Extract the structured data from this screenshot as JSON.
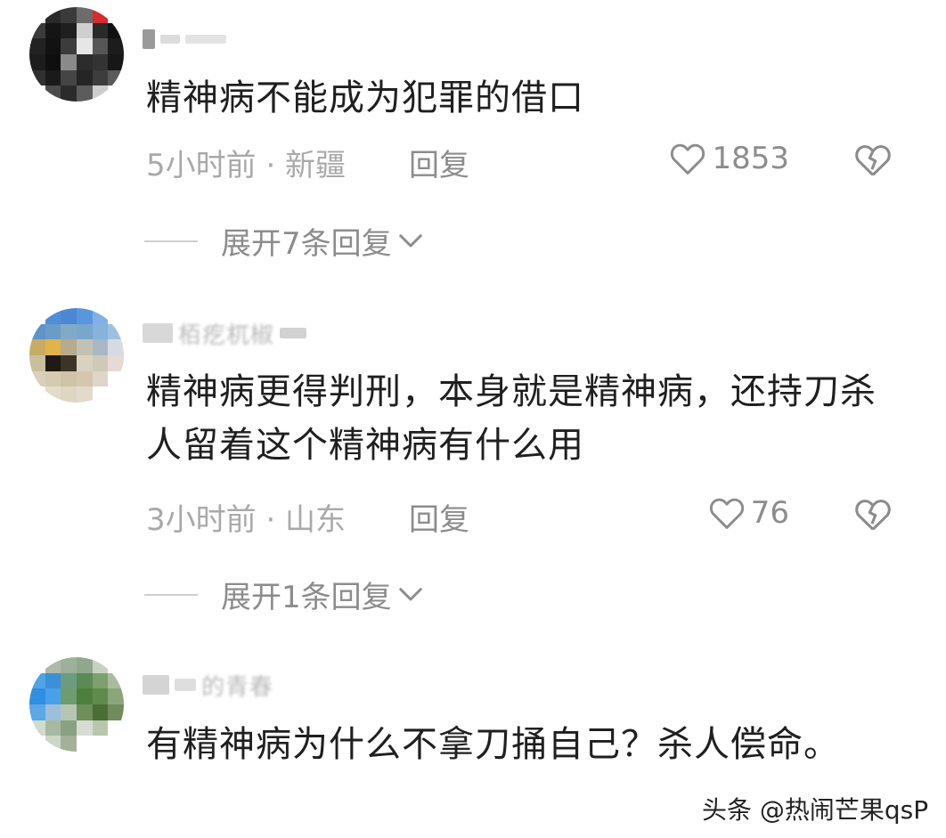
{
  "comments": [
    {
      "text": "精神病不能成为犯罪的借口",
      "time_location": "5小时前 · 新疆",
      "reply_label": "回复",
      "likes": "1853",
      "expand_label": "展开7条回复"
    },
    {
      "username_partial": "栢疙杌椒",
      "text": "精神病更得判刑，本身就是精神病，还持刀杀人留着这个精神病有什么用",
      "time_location": "3小时前 · 山东",
      "reply_label": "回复",
      "likes": "76",
      "expand_label": "展开1条回复"
    },
    {
      "username_partial": "的青春",
      "text": "有精神病为什么不拿刀捅自己？杀人偿命。"
    }
  ],
  "watermark": "头条 @热闹芒果qsP",
  "colors": {
    "meta_text": "#a9a9a9",
    "action_text": "#8c8c8c",
    "divider": "#cfcfcf"
  },
  "icons": {
    "like": "heart-outline-icon",
    "dislike": "broken-heart-icon",
    "expand": "chevron-down-icon"
  }
}
